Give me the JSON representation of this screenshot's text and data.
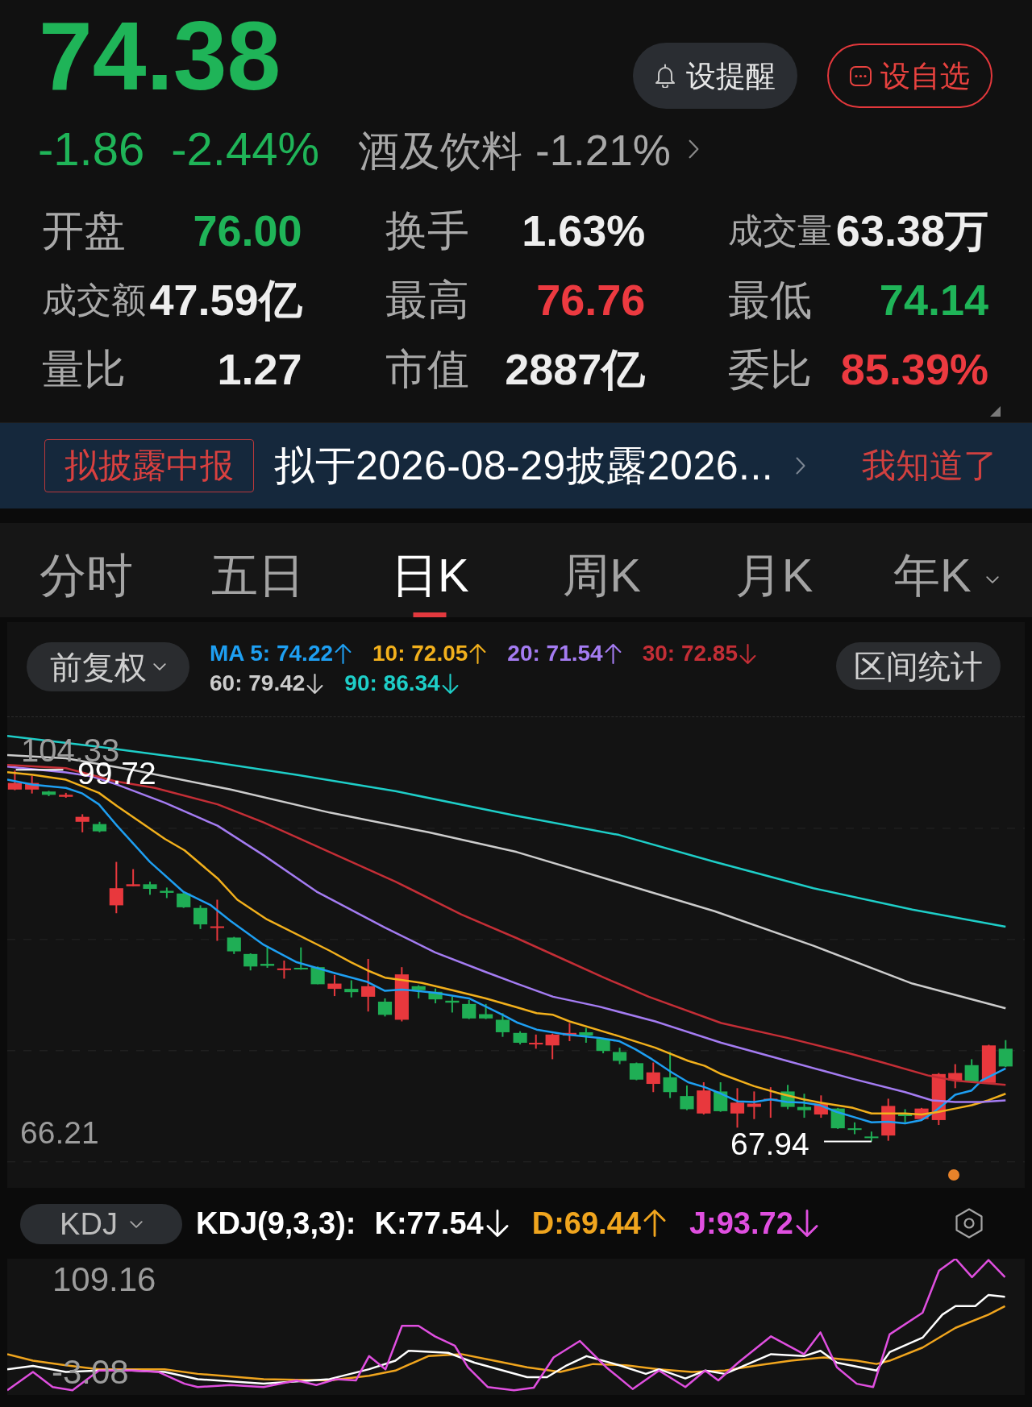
{
  "quote": {
    "price": "74.38",
    "change": "-1.86",
    "change_percent": "-2.44%",
    "rising": false,
    "sector": {
      "name": "酒及饮料",
      "change": "-1.21%"
    }
  },
  "actions": [
    {
      "kind": "alert",
      "label": "设提醒"
    },
    {
      "kind": "watchlist",
      "label": "设自选"
    }
  ],
  "stats": [
    {
      "label": "开盘",
      "value": "76.00",
      "color": "#1fb458"
    },
    {
      "label": "换手",
      "value": "1.63%",
      "color": "#eeeeee"
    },
    {
      "label": "成交量",
      "value": "63.38万",
      "color": "#eeeeee"
    },
    {
      "label": "成交额",
      "value": "47.59亿",
      "color": "#eeeeee"
    },
    {
      "label": "最高",
      "value": "76.76",
      "color": "#ec3a40"
    },
    {
      "label": "最低",
      "value": "74.14",
      "color": "#1fb458"
    },
    {
      "label": "量比",
      "value": "1.27",
      "color": "#eeeeee"
    },
    {
      "label": "市值",
      "value": "2887亿",
      "color": "#eeeeee"
    },
    {
      "label": "委比",
      "value": "85.39%",
      "color": "#ec3a40"
    }
  ],
  "notice": {
    "tag": "拟披露中报",
    "text": "拟于2026-08-29披露2026...",
    "dismiss": "我知道了"
  },
  "tabs": [
    {
      "label": "分时",
      "selected": false,
      "menu": false
    },
    {
      "label": "五日",
      "selected": false,
      "menu": false
    },
    {
      "label": "日K",
      "selected": true,
      "menu": false
    },
    {
      "label": "周K",
      "selected": false,
      "menu": false
    },
    {
      "label": "月K",
      "selected": false,
      "menu": false
    },
    {
      "label": "年K",
      "selected": false,
      "menu": true
    }
  ],
  "chart_toolbar": {
    "adjust": "前复权",
    "ma_legend": [
      {
        "label": "MA 5: 74.22",
        "rising": true,
        "color": "#1e9ff2"
      },
      {
        "label": "10: 72.05",
        "rising": true,
        "color": "#f2b01c"
      },
      {
        "label": "20: 71.54",
        "rising": true,
        "color": "#a47cf2"
      },
      {
        "label": "30: 72.85",
        "rising": false,
        "color": "#c42e36"
      },
      {
        "label": "60: 79.42",
        "rising": false,
        "color": "#cccccc"
      },
      {
        "label": "90: 86.34",
        "rising": false,
        "color": "#1ecec8"
      }
    ],
    "range_button": "区间统计"
  },
  "price_chart": {
    "top_label": "104.33",
    "high_label": "99.72",
    "low_label": "67.94",
    "bottom_label": "66.21"
  },
  "indicator": {
    "selector": "KDJ",
    "title": "KDJ(9,3,3):",
    "values": [
      {
        "label": "K:77.54",
        "rising": false,
        "color": "#ffffff"
      },
      {
        "label": "D:69.44",
        "rising": true,
        "color": "#f0a51e"
      },
      {
        "label": "J:93.72",
        "rising": false,
        "color": "#e04fe0"
      }
    ]
  },
  "indicator_chart": {
    "top_label": "109.16",
    "bottom_label": "-3.08"
  }
}
